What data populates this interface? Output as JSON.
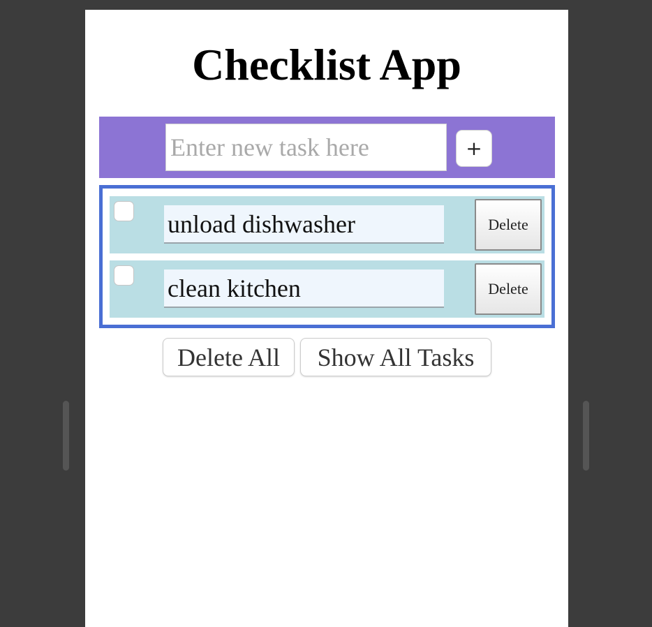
{
  "app": {
    "title": "Checklist App"
  },
  "new_task": {
    "placeholder": "Enter new task here",
    "value": "",
    "add_label": "+"
  },
  "tasks": [
    {
      "text": "unload dishwasher",
      "checked": false,
      "delete_label": "Delete"
    },
    {
      "text": "clean kitchen",
      "checked": false,
      "delete_label": "Delete"
    }
  ],
  "actions": {
    "delete_all_label": "Delete All",
    "show_all_label": "Show All Tasks"
  },
  "colors": {
    "input_bar": "#8c74d4",
    "list_border": "#4a6fd4",
    "row_background": "#badee4",
    "window_background": "#3c3c3c"
  }
}
